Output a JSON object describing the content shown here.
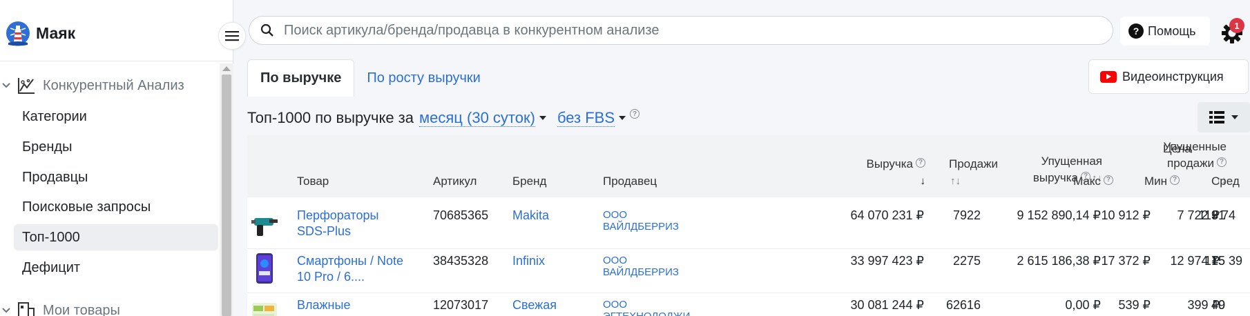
{
  "app": {
    "name": "Маяк",
    "search_placeholder": "Поиск артикула/бренда/продавца в конкурентном анализе",
    "help_label": "Помощь",
    "notifications_count": "1",
    "icons": [
      "lighthouse-logo-icon",
      "menu-icon",
      "search-icon",
      "question-icon",
      "gear-icon"
    ]
  },
  "sidebar": {
    "section_analysis": "Конкурентный Анализ",
    "items": [
      {
        "label": "Категории",
        "active": false
      },
      {
        "label": "Бренды",
        "active": false
      },
      {
        "label": "Продавцы",
        "active": false
      },
      {
        "label": "Поисковые запросы",
        "active": false
      },
      {
        "label": "Топ-1000",
        "active": true
      },
      {
        "label": "Дефицит",
        "active": false
      }
    ],
    "section_my_goods": "Мои товары"
  },
  "tabs": [
    {
      "label": "По выручке",
      "active": true
    },
    {
      "label": "По росту выручки",
      "active": false
    }
  ],
  "video_button": "Видеоинструкция",
  "headline": {
    "prefix": "Топ-1000 по выручке за",
    "period": "месяц (30 суток)",
    "fbs": "без FBS"
  },
  "table": {
    "headers": {
      "product": "Товар",
      "article": "Артикул",
      "brand": "Бренд",
      "seller": "Продавец",
      "revenue": "Выручка",
      "sales": "Продажи",
      "lost_revenue_1": "Упущенная",
      "lost_revenue_2": "выручка",
      "lost_sales_1": "Упущенные",
      "lost_sales_2": "продажи",
      "price": "Цена",
      "price_max": "Макс",
      "price_min": "Мин",
      "price_avg": "Сред"
    },
    "rows": [
      {
        "product_1": "Перфораторы",
        "product_2": "SDS-Plus",
        "article": "70685365",
        "brand": "Makita",
        "seller_1": "ООО",
        "seller_2": "ВАЙЛДБЕРРИЗ",
        "revenue": "64 070 231 ₽",
        "sales": "7922",
        "lost_revenue": "9 152 890,14 ₽",
        "lost_sales": "1131",
        "price_max": "10 912 ₽",
        "price_min": "7 722 ₽",
        "price_avg": "9 74"
      },
      {
        "product_1": "Смартфоны / Note",
        "product_2": "10 Pro / 6....",
        "article": "38435328",
        "brand": "Infinix",
        "seller_1": "ООО",
        "seller_2": "ВАЙЛДБЕРРИЗ",
        "revenue": "33 997 423 ₽",
        "sales": "2275",
        "lost_revenue": "2 615 186,38 ₽",
        "lost_sales": "175",
        "price_max": "17 372 ₽",
        "price_min": "12 974 ₽",
        "price_avg": "15 39"
      },
      {
        "product_1": "Влажные",
        "product_2": "",
        "article": "12073017",
        "brand": "Свежая",
        "seller_1": "ООО",
        "seller_2": "ЭГТЕХНОЛОДЖИ",
        "revenue": "30 081 244 ₽",
        "sales": "62616",
        "lost_revenue": "0,00 ₽",
        "lost_sales": "0",
        "price_max": "539 ₽",
        "price_min": "399 ₽",
        "price_avg": "49"
      }
    ]
  }
}
